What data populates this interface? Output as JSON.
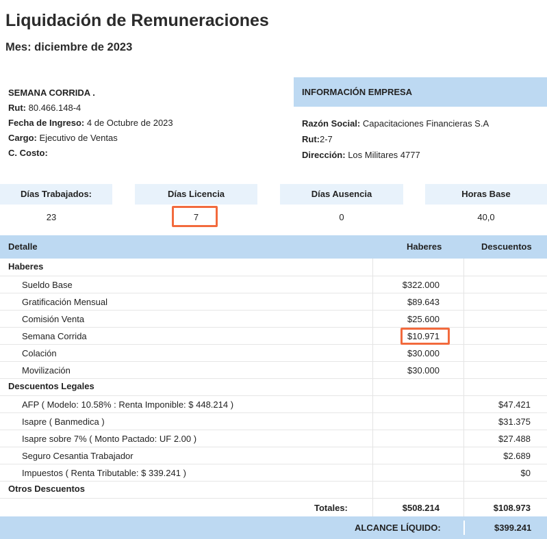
{
  "header": {
    "title": "Liquidación de Remuneraciones",
    "period": "Mes: diciembre de 2023"
  },
  "employee": {
    "name": "SEMANA CORRIDA .",
    "rut_label": "Rut:",
    "rut": "80.466.148-4",
    "ingreso_label": "Fecha de Ingreso:",
    "ingreso": "4 de Octubre de 2023",
    "cargo_label": "Cargo:",
    "cargo": "Ejecutivo de Ventas",
    "costo_label": "C. Costo:"
  },
  "company": {
    "header": "INFORMACIÓN EMPRESA",
    "razon_label": "Razón Social:",
    "razon": "Capacitaciones Financieras S.A",
    "rut_label": "Rut:",
    "rut": "2-7",
    "dir_label": "Dirección:",
    "dir": "Los Militares 4777"
  },
  "stats": [
    {
      "label": "Días Trabajados:",
      "value": "23"
    },
    {
      "label": "Días Licencia",
      "value": "7"
    },
    {
      "label": "Días Ausencia",
      "value": "0"
    },
    {
      "label": "Horas Base",
      "value": "40,0"
    }
  ],
  "table": {
    "col_detalle": "Detalle",
    "col_haberes": "Haberes",
    "col_descuentos": "Descuentos",
    "sec_haberes": "Haberes",
    "haberes": [
      {
        "label": "Sueldo Base",
        "amount": "$322.000"
      },
      {
        "label": "Gratificación Mensual",
        "amount": "$89.643"
      },
      {
        "label": "Comisión Venta",
        "amount": "$25.600"
      },
      {
        "label": "Semana Corrida",
        "amount": "$10.971"
      },
      {
        "label": "Colación",
        "amount": "$30.000"
      },
      {
        "label": "Movilización",
        "amount": "$30.000"
      }
    ],
    "sec_descuentos": "Descuentos Legales",
    "descuentos": [
      {
        "label": "AFP ( Modelo: 10.58% : Renta Imponible: $ 448.214 )",
        "amount": "$47.421"
      },
      {
        "label": "Isapre ( Banmedica )",
        "amount": "$31.375"
      },
      {
        "label": "Isapre sobre 7% ( Monto Pactado: UF 2.00 )",
        "amount": "$27.488"
      },
      {
        "label": "Seguro Cesantia Trabajador",
        "amount": "$2.689"
      },
      {
        "label": "Impuestos ( Renta Tributable: $ 339.241 )",
        "amount": "$0"
      }
    ],
    "sec_otros": "Otros Descuentos",
    "totales_label": "Totales:",
    "total_haberes": "$508.214",
    "total_descuentos": "$108.973",
    "alcance_label": "ALCANCE LÍQUIDO:",
    "alcance": "$399.241"
  },
  "colors": {
    "header_blue": "#bdd9f2",
    "stat_blue": "#e8f2fb",
    "highlight": "#f26a3d"
  }
}
